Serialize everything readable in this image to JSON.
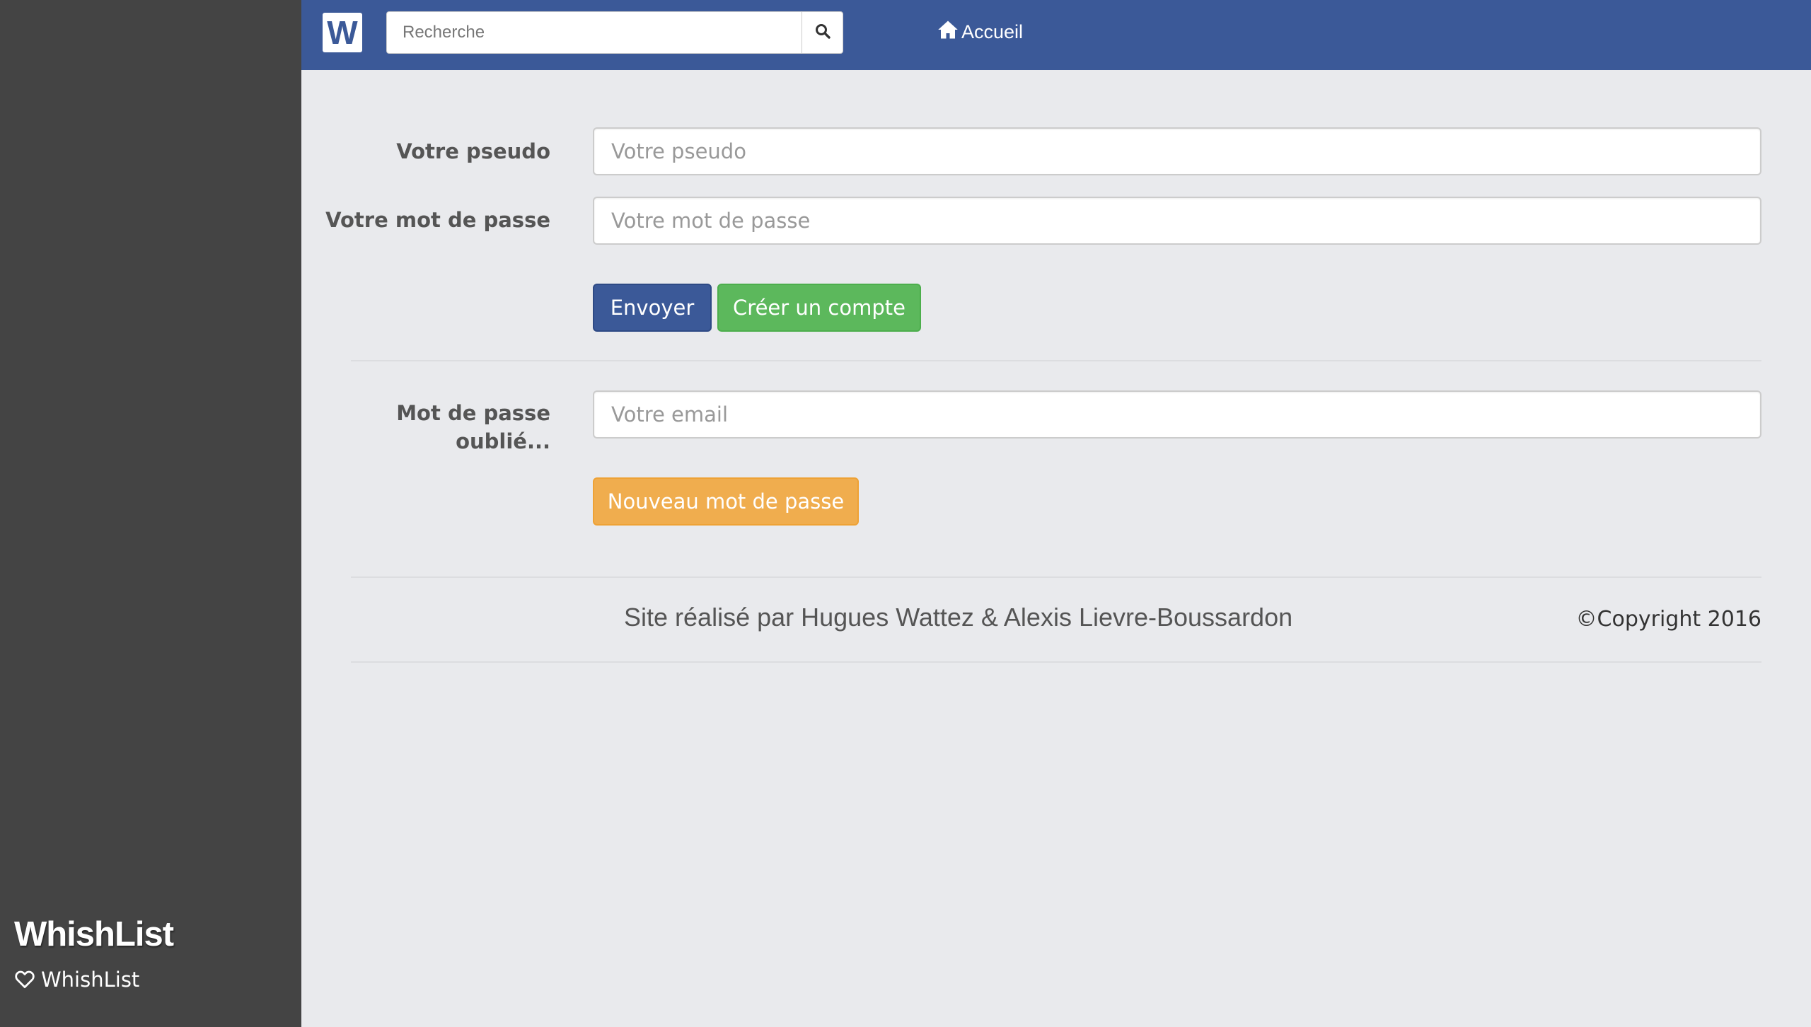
{
  "sidebar": {
    "brand": "WhishList",
    "link_label": "WhishList",
    "link_icon": "heart-outline-icon"
  },
  "navbar": {
    "logo_letter": "W",
    "search_placeholder": "Recherche",
    "search_icon": "search-icon",
    "home_label": "Accueil",
    "home_icon": "home-icon",
    "bg_color": "#3b5998"
  },
  "login_form": {
    "pseudo_label": "Votre pseudo",
    "pseudo_placeholder": "Votre pseudo",
    "password_label": "Votre mot de passe",
    "password_placeholder": "Votre mot de passe",
    "submit_label": "Envoyer",
    "create_account_label": "Créer un compte"
  },
  "forgot_form": {
    "label": "Mot de passe oublié...",
    "email_placeholder": "Votre email",
    "submit_label": "Nouveau mot de passe"
  },
  "footer": {
    "credit": "Site réalisé par Hugues Wattez & Alexis Lievre-Boussardon",
    "copyright": "©Copyright 2016"
  },
  "colors": {
    "primary": "#3b5998",
    "success": "#5cb85c",
    "warning": "#f0ad4e",
    "sidebar": "#444444",
    "page_bg": "#e9eaed"
  }
}
